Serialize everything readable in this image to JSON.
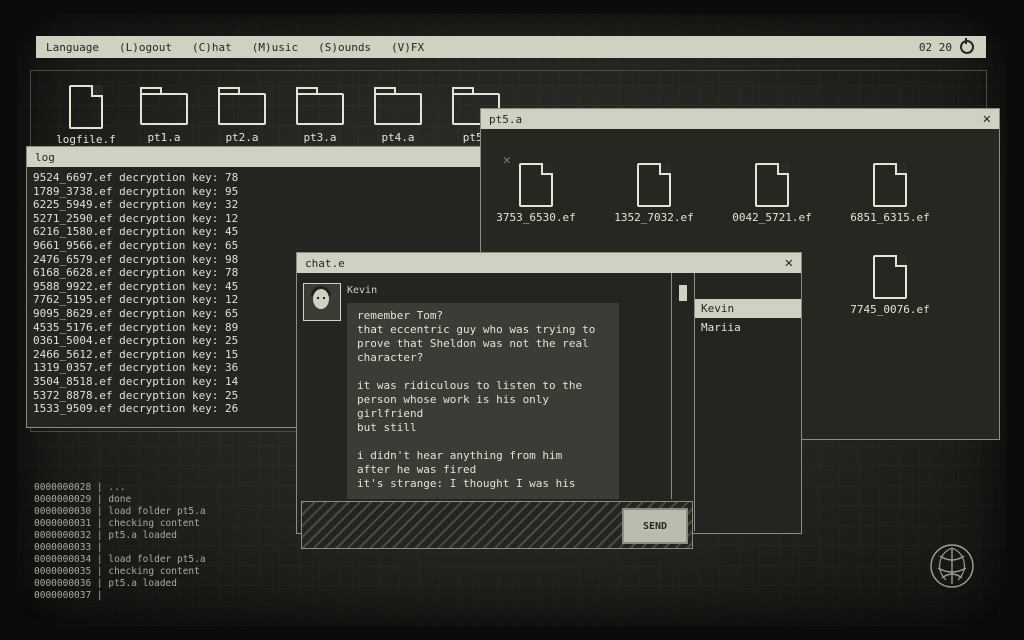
{
  "menu": {
    "items": [
      "Language",
      "(L)ogout",
      "(C)hat",
      "(M)usic",
      "(S)ounds",
      "(V)FX"
    ],
    "clock": "02 20"
  },
  "desktop": {
    "icons": [
      {
        "label": "logfile.f",
        "type": "file"
      },
      {
        "label": "pt1.a",
        "type": "folder"
      },
      {
        "label": "pt2.a",
        "type": "folder"
      },
      {
        "label": "pt3.a",
        "type": "folder"
      },
      {
        "label": "pt4.a",
        "type": "folder"
      },
      {
        "label": "pt5.",
        "type": "folder"
      }
    ]
  },
  "log_window": {
    "title": "log",
    "lines": [
      "9524_6697.ef decryption key: 78",
      "1789_3738.ef decryption key: 95",
      "6225_5949.ef decryption key: 32",
      "5271_2590.ef decryption key: 12",
      "6216_1580.ef decryption key: 45",
      "9661_9566.ef decryption key: 65",
      "2476_6579.ef decryption key: 98",
      "6168_6628.ef decryption key: 78",
      "9588_9922.ef decryption key: 45",
      "7762_5195.ef decryption key: 12",
      "9095_8629.ef decryption key: 65",
      "4535_5176.ef decryption key: 89",
      "0361_5004.ef decryption key: 25",
      "2466_5612.ef decryption key: 15",
      "1319_0357.ef decryption key: 36",
      "3504_8518.ef decryption key: 14",
      "5372_8878.ef decryption key: 25",
      "1533_9509.ef decryption key: 26"
    ]
  },
  "pt5_window": {
    "title": "pt5.a",
    "files": [
      "3753_6530.ef",
      "1352_7032.ef",
      "0042_5721.ef",
      "6851_6315.ef",
      "ef",
      "7745_0076.ef"
    ]
  },
  "chat_window": {
    "title": "chat.e",
    "sender": "Kevin",
    "message_lines": [
      "remember Tom?",
      "that eccentric guy who was trying to",
      "prove that Sheldon was not the real",
      "character?",
      "",
      "it was ridiculous to listen to the",
      "person whose work is his only",
      "girlfriend",
      "but still",
      "",
      "i didn't hear anything from him",
      "after he was fired",
      "it's strange: I thought I was his"
    ],
    "users": [
      "Kevin",
      "Mariia"
    ],
    "send_label": "SEND"
  },
  "console": {
    "lines": [
      "0000000028 | ...",
      "0000000029 | done",
      "0000000030 | load folder pt5.a",
      "0000000031 | checking content",
      "0000000032 | pt5.a loaded",
      "0000000033 |",
      "0000000034 | load folder pt5.a",
      "0000000035 | checking content",
      "0000000036 | pt5.a loaded",
      "0000000037 |"
    ]
  },
  "colors": {
    "panel": "#cfd2c3",
    "background": "#262721",
    "text": "#e2e4d7"
  }
}
